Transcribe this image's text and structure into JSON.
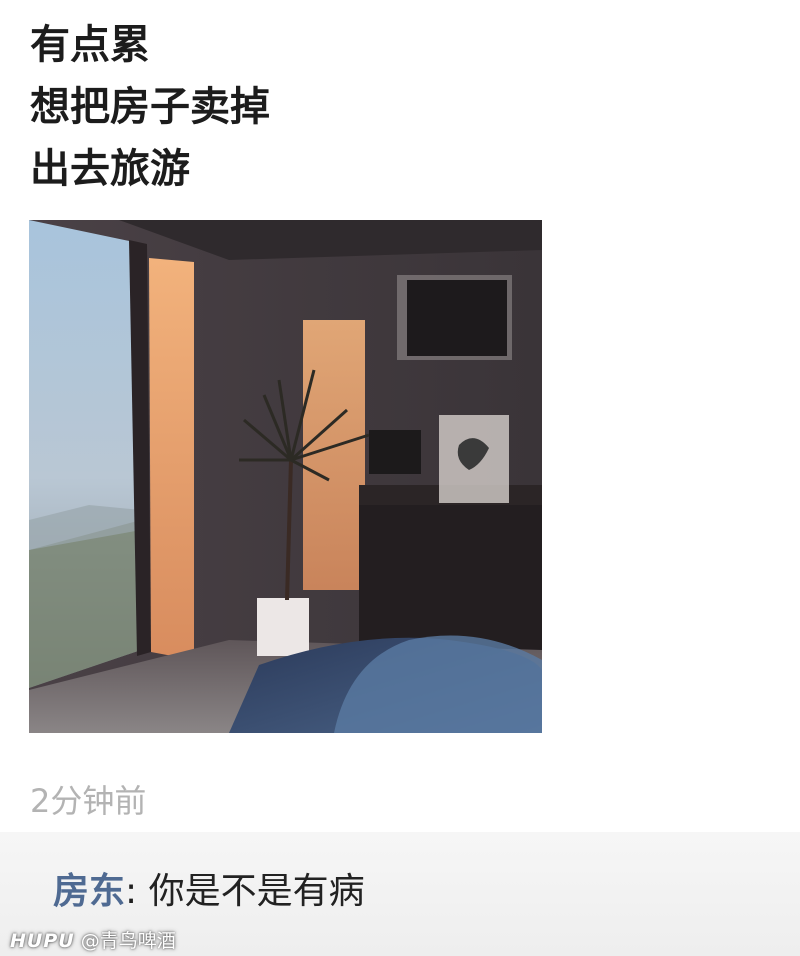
{
  "post": {
    "lines": [
      "有点累",
      "想把房子卖掉",
      "出去旅游"
    ],
    "time": "2分钟前"
  },
  "comment": {
    "author": "房东",
    "separator": ": ",
    "text": "你是不是有病"
  },
  "watermark": {
    "brand": "HUPU",
    "handle": " @青鸟啤酒"
  },
  "colors": {
    "comment_author": "#4f6a92",
    "timestamp": "#b3b3b3",
    "comment_bg": "#f2f2f2"
  }
}
